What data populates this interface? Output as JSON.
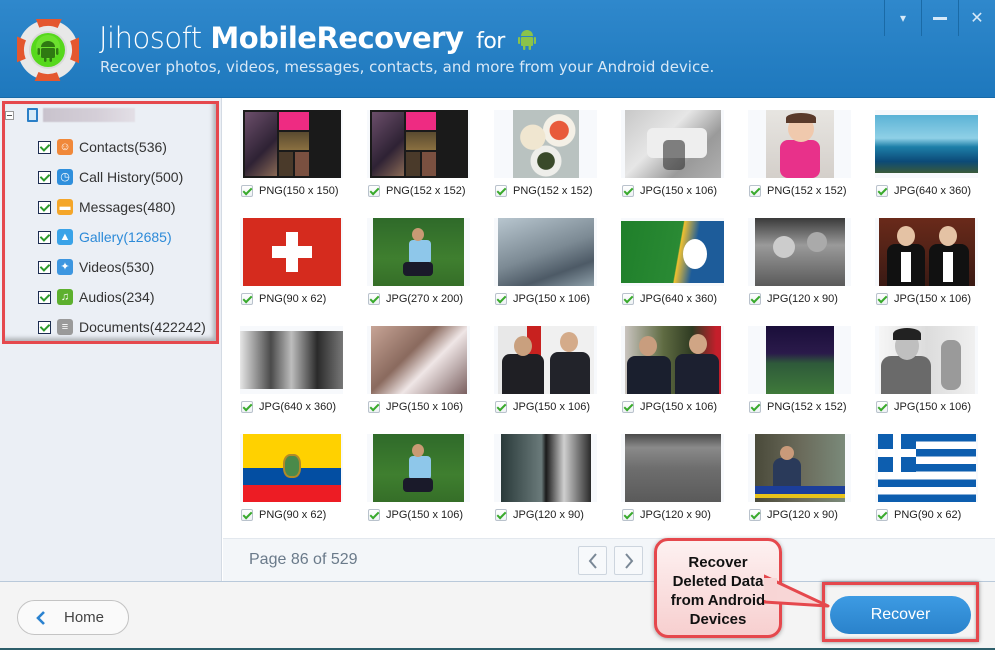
{
  "header": {
    "title_light": "Jihosoft",
    "title_bold": "MobileRecovery",
    "title_for": "for",
    "subtitle": "Recover photos, videos, messages, contacts, and more from your Android device.",
    "window_controls": [
      {
        "name": "menu-dropdown",
        "glyph": "▾"
      },
      {
        "name": "minimize",
        "glyph": "—"
      },
      {
        "name": "close",
        "glyph": "✕"
      }
    ]
  },
  "sidebar": {
    "device_name": "",
    "categories": [
      {
        "label": "Contacts(536)",
        "icon": "contacts-icon",
        "color": "#f0883a",
        "glyph": "☺",
        "active": false
      },
      {
        "label": "Call History(500)",
        "icon": "call-history-icon",
        "color": "#2f8fdc",
        "glyph": "◷",
        "active": false
      },
      {
        "label": "Messages(480)",
        "icon": "messages-icon",
        "color": "#f4a62a",
        "glyph": "▬",
        "active": false
      },
      {
        "label": "Gallery(12685)",
        "icon": "gallery-icon",
        "color": "#3aa3e8",
        "glyph": "▲",
        "active": true
      },
      {
        "label": "Videos(530)",
        "icon": "videos-icon",
        "color": "#3d96e0",
        "glyph": "✦",
        "active": false
      },
      {
        "label": "Audios(234)",
        "icon": "audios-icon",
        "color": "#5db02e",
        "glyph": "♫",
        "active": false
      },
      {
        "label": "Documents(422242)",
        "icon": "documents-icon",
        "color": "#9a9a9a",
        "glyph": "≡",
        "active": false
      }
    ]
  },
  "gallery": {
    "items": [
      {
        "caption": "PNG(150 x 150)",
        "kind": "collage",
        "checked": true
      },
      {
        "caption": "PNG(152 x 152)",
        "kind": "collage",
        "checked": true
      },
      {
        "caption": "PNG(152 x 152)",
        "kind": "food",
        "checked": true
      },
      {
        "caption": "JPG(150 x 106)",
        "kind": "car",
        "checked": true
      },
      {
        "caption": "PNG(152 x 152)",
        "kind": "baby",
        "checked": true
      },
      {
        "caption": "JPG(640 x 360)",
        "kind": "ocean",
        "checked": true
      },
      {
        "caption": "PNG(90 x 62)",
        "kind": "flag-switzerland",
        "checked": true
      },
      {
        "caption": "JPG(270 x 200)",
        "kind": "soccer",
        "checked": true
      },
      {
        "caption": "JPG(150 x 106)",
        "kind": "wreck",
        "checked": true
      },
      {
        "caption": "JPG(640 x 360)",
        "kind": "poster",
        "checked": true
      },
      {
        "caption": "JPG(120 x 90)",
        "kind": "bw-photo",
        "checked": true
      },
      {
        "caption": "JPG(150 x 106)",
        "kind": "tuxedo",
        "checked": true
      },
      {
        "caption": "JPG(640 x 360)",
        "kind": "bw-couple",
        "checked": true
      },
      {
        "caption": "JPG(150 x 106)",
        "kind": "room",
        "checked": true
      },
      {
        "caption": "JPG(150 x 106)",
        "kind": "handshake",
        "checked": true
      },
      {
        "caption": "JPG(150 x 106)",
        "kind": "handshake2",
        "checked": true
      },
      {
        "caption": "PNG(152 x 152)",
        "kind": "night-field",
        "checked": true
      },
      {
        "caption": "JPG(150 x 106)",
        "kind": "bw-man",
        "checked": true
      },
      {
        "caption": "PNG(90 x 62)",
        "kind": "flag-ecuador",
        "checked": true
      },
      {
        "caption": "JPG(150 x 106)",
        "kind": "soccer",
        "checked": true
      },
      {
        "caption": "JPG(120 x 90)",
        "kind": "bw-portrait",
        "checked": true
      },
      {
        "caption": "JPG(120 x 90)",
        "kind": "bw-landscape",
        "checked": true
      },
      {
        "caption": "JPG(120 x 90)",
        "kind": "news",
        "checked": true
      },
      {
        "caption": "PNG(90 x 62)",
        "kind": "flag-greece",
        "checked": true
      }
    ]
  },
  "pager": {
    "text": "Page 86 of 529",
    "current_page": 86,
    "total_pages": 529
  },
  "footer": {
    "home_label": "Home",
    "recover_label": "Recover"
  },
  "callout": {
    "lines": [
      "Recover",
      "Deleted Data",
      "from Android",
      "Devices"
    ]
  },
  "colors": {
    "header_blue": "#2a83c7",
    "accent_blue": "#2c8ad8",
    "highlight_red": "#e5484d",
    "android_green": "#8bc34a"
  }
}
